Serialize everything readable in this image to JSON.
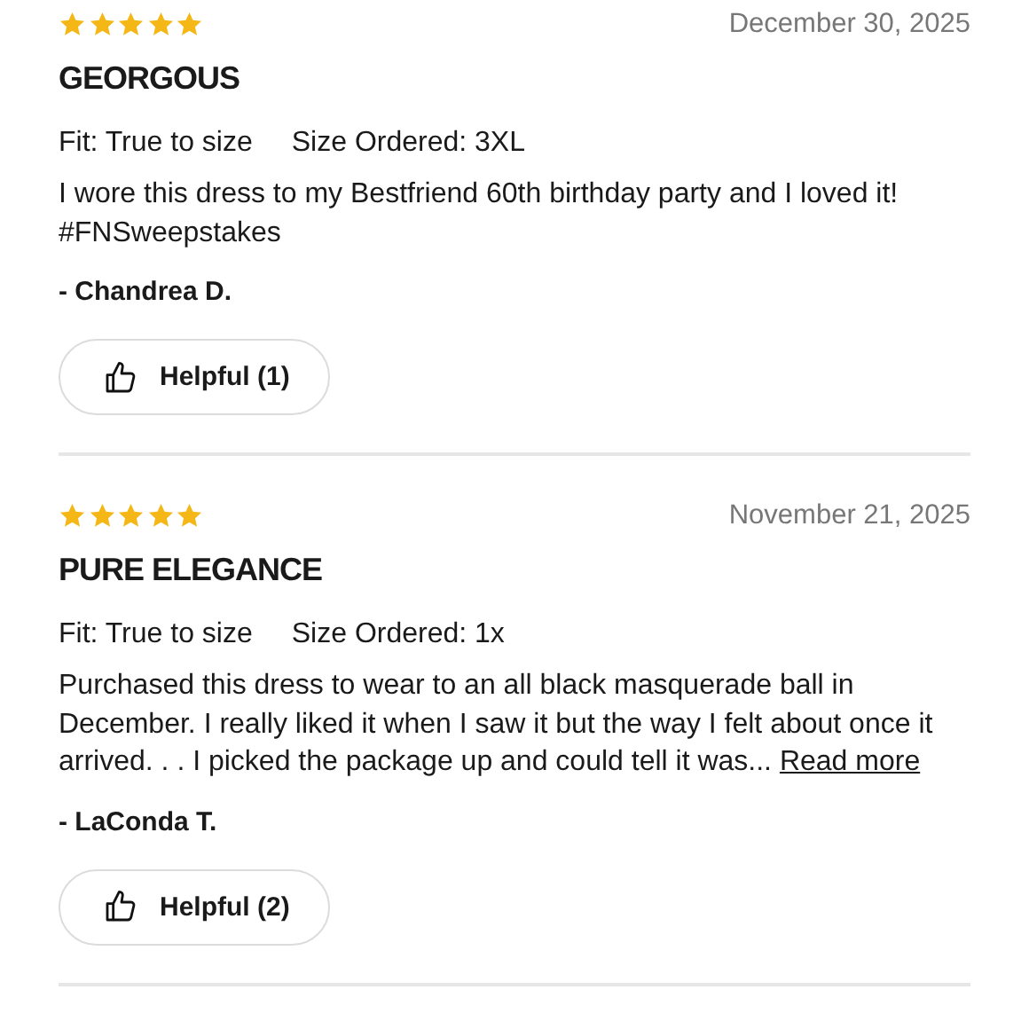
{
  "reviews": [
    {
      "stars": 5,
      "date": "December 30, 2025",
      "title": "GEORGOUS",
      "fit": "Fit: True to size",
      "size": "Size Ordered: 3XL",
      "body": "I wore this dress to my Bestfriend 60th birthday party and I loved it! #FNSweepstakes",
      "author": "- Chandrea D.",
      "helpful": "Helpful (1)"
    },
    {
      "stars": 5,
      "date": "November 21, 2025",
      "title": "PURE ELEGANCE",
      "fit": "Fit: True to size",
      "size": "Size Ordered: 1x",
      "body": "Purchased this dress to wear to an all black masquerade ball in December. I really liked it when I saw it but the way I felt about once it arrived. . . I picked the package up and could tell it was...",
      "read_more": "Read more",
      "author": "- LaConda T.",
      "helpful": "Helpful (2)"
    }
  ]
}
